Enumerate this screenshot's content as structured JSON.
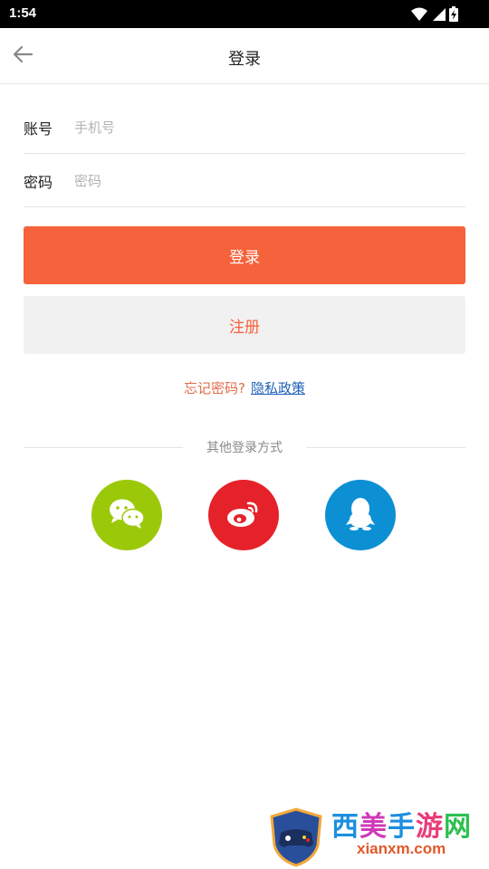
{
  "status_bar": {
    "time": "1:54",
    "icons": [
      "wifi-icon",
      "signal-icon",
      "battery-charging-icon"
    ]
  },
  "header": {
    "title": "登录",
    "back_icon": "arrow-left-icon"
  },
  "form": {
    "account": {
      "label": "账号",
      "placeholder": "手机号",
      "value": ""
    },
    "password": {
      "label": "密码",
      "placeholder": "密码",
      "value": ""
    }
  },
  "buttons": {
    "login_label": "登录",
    "register_label": "注册"
  },
  "links": {
    "forgot_password": "忘记密码?",
    "privacy_policy": "隐私政策"
  },
  "social": {
    "divider_text": "其他登录方式",
    "providers": [
      {
        "icon": "wechat-icon",
        "color": "#9bc90a"
      },
      {
        "icon": "weibo-icon",
        "color": "#e5222a"
      },
      {
        "icon": "qq-icon",
        "color": "#0d8fd4"
      }
    ]
  },
  "watermark": {
    "brand": "西美手游网",
    "url": "xianxm.com"
  },
  "colors": {
    "accent": "#f6623c",
    "register_bg": "#f1f1f1",
    "privacy_link": "#1f5fb8"
  }
}
